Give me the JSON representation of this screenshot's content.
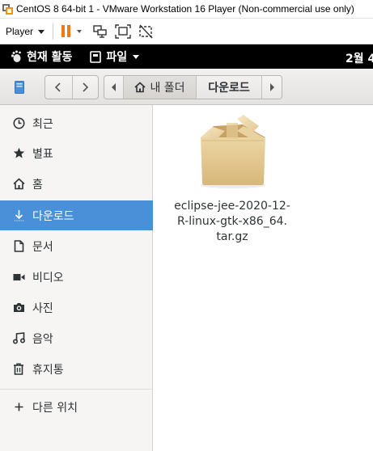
{
  "vmware": {
    "title": "CentOS 8 64-bit 1 - VMware Workstation 16 Player (Non-commercial use only)",
    "player_menu": "Player",
    "icons": [
      "pause-icon",
      "send-keys-icon",
      "fit-guest-icon",
      "unity-icon"
    ]
  },
  "gnome": {
    "activities": "현재 활동",
    "app_menu": "파일",
    "clock": "2월 4"
  },
  "nautilus": {
    "path": {
      "home": "내 폴더",
      "current": "다운로드"
    },
    "sidebar": {
      "items": [
        {
          "label": "최근",
          "icon": "clock-icon"
        },
        {
          "label": "별표",
          "icon": "star-icon"
        },
        {
          "label": "홈",
          "icon": "home-icon"
        },
        {
          "label": "다운로드",
          "icon": "download-icon",
          "active": true
        },
        {
          "label": "문서",
          "icon": "document-icon"
        },
        {
          "label": "비디오",
          "icon": "video-icon"
        },
        {
          "label": "사진",
          "icon": "camera-icon"
        },
        {
          "label": "음악",
          "icon": "music-icon"
        },
        {
          "label": "휴지통",
          "icon": "trash-icon"
        }
      ],
      "other_locations": "다른 위치"
    },
    "files": [
      {
        "name_lines": [
          "eclipse-jee-2020-12-",
          "R-linux-gtk-x86_64.",
          "tar.gz"
        ],
        "icon": "package-archive-icon"
      }
    ],
    "colors": {
      "accent": "#4a90d9",
      "sidebar_bg": "#f6f5f4"
    }
  }
}
